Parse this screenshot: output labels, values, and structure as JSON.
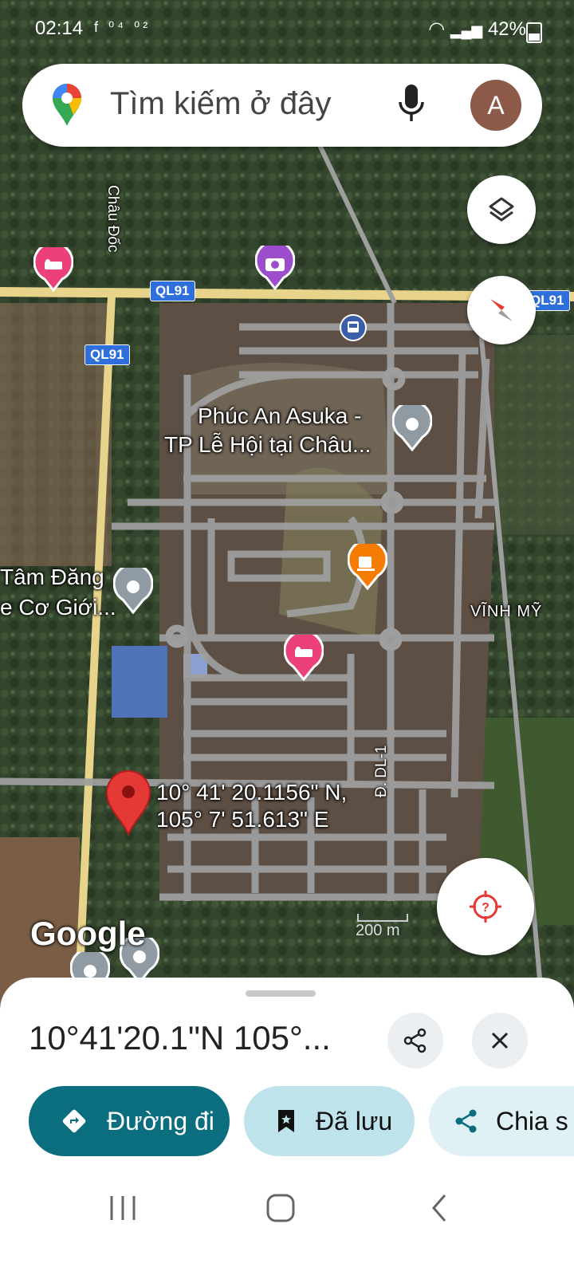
{
  "status_bar": {
    "time": "02:14",
    "left_icons": "f ⁰⁴ ⁰²",
    "battery": "42%"
  },
  "search": {
    "placeholder": "Tìm kiếm ở đây",
    "avatar_letter": "A"
  },
  "map": {
    "road_labels": [
      "QL91",
      "QL91",
      "QL91"
    ],
    "street_name": "Châu Đốc",
    "street_name_2": "Đ. DL-1",
    "place_1_line1": "Phúc An Asuka -",
    "place_1_line2": "TP Lễ Hội tại Châu...",
    "place_2_line1": "Tâm Đăng",
    "place_2_line2": "e Cơ Giới...",
    "area_label": "VĨNH MỸ",
    "pin_coord_line1": "10° 41' 20.1156\" N,",
    "pin_coord_line2": "105° 7' 51.613\" E",
    "google_logo": "Google",
    "scale_text": "200 m"
  },
  "sheet": {
    "title": "10°41'20.1\"N 105°...",
    "buttons": {
      "directions": "Đường đi",
      "save": "Đã lưu",
      "share": "Chia s"
    }
  },
  "colors": {
    "primary_teal": "#0b6e7e",
    "save_chip": "#bfe3ea",
    "share_chip": "#dff1f5",
    "pin_red": "#e53935",
    "hotel_pink": "#ec407a",
    "cafe_orange": "#f57c00",
    "camera_purple": "#9c4dcc"
  }
}
